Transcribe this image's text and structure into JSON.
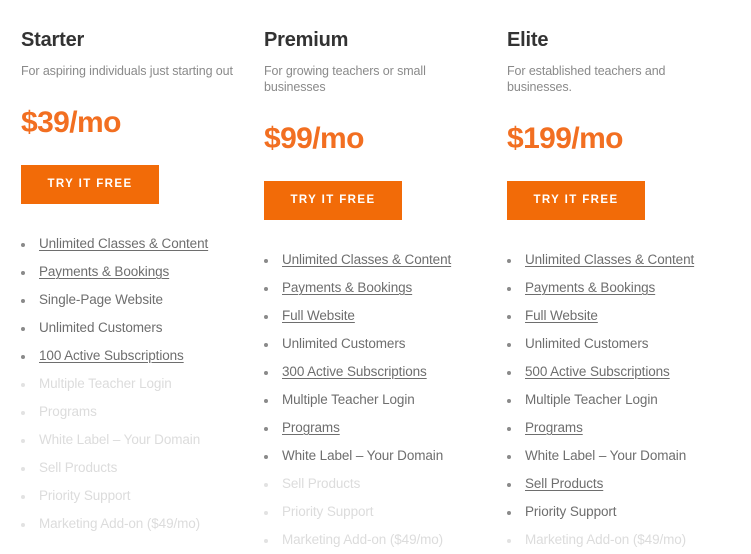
{
  "theme": {
    "accent_orange": "#F26F21",
    "button_orange": "#F26B08",
    "heading_color": "#333333",
    "feature_color": "#6e6e6e",
    "disabled_color": "#dcdcdc"
  },
  "plans": [
    {
      "name": "Starter",
      "tagline": "For aspiring individuals just starting out",
      "price": "$39/mo",
      "cta_label": "TRY IT FREE",
      "features": [
        {
          "label": "Unlimited Classes & Content",
          "enabled": true,
          "has_info": true
        },
        {
          "label": "Payments & Bookings",
          "enabled": true,
          "has_info": true
        },
        {
          "label": "Single-Page Website",
          "enabled": true,
          "has_info": false
        },
        {
          "label": "Unlimited Customers",
          "enabled": true,
          "has_info": false
        },
        {
          "label": "100 Active Subscriptions",
          "enabled": true,
          "has_info": true
        },
        {
          "label": "Multiple Teacher Login",
          "enabled": false,
          "has_info": false
        },
        {
          "label": "Programs",
          "enabled": false,
          "has_info": false
        },
        {
          "label": "White Label – Your Domain",
          "enabled": false,
          "has_info": false
        },
        {
          "label": "Sell Products",
          "enabled": false,
          "has_info": false
        },
        {
          "label": "Priority Support",
          "enabled": false,
          "has_info": false
        },
        {
          "label": "Marketing Add-on ($49/mo)",
          "enabled": false,
          "has_info": false
        }
      ]
    },
    {
      "name": "Premium",
      "tagline": "For growing teachers or small businesses",
      "price": "$99/mo",
      "cta_label": "TRY IT FREE",
      "features": [
        {
          "label": "Unlimited Classes & Content",
          "enabled": true,
          "has_info": true
        },
        {
          "label": "Payments & Bookings",
          "enabled": true,
          "has_info": true
        },
        {
          "label": "Full Website",
          "enabled": true,
          "has_info": true
        },
        {
          "label": "Unlimited Customers",
          "enabled": true,
          "has_info": false
        },
        {
          "label": "300 Active Subscriptions",
          "enabled": true,
          "has_info": true
        },
        {
          "label": "Multiple Teacher Login",
          "enabled": true,
          "has_info": false
        },
        {
          "label": "Programs",
          "enabled": true,
          "has_info": true
        },
        {
          "label": "White Label – Your Domain",
          "enabled": true,
          "has_info": false
        },
        {
          "label": "Sell Products",
          "enabled": false,
          "has_info": false
        },
        {
          "label": "Priority Support",
          "enabled": false,
          "has_info": false
        },
        {
          "label": "Marketing Add-on ($49/mo)",
          "enabled": false,
          "has_info": false
        }
      ]
    },
    {
      "name": "Elite",
      "tagline": "For established teachers and businesses.",
      "price": "$199/mo",
      "cta_label": "TRY IT FREE",
      "features": [
        {
          "label": "Unlimited Classes & Content",
          "enabled": true,
          "has_info": true
        },
        {
          "label": "Payments & Bookings",
          "enabled": true,
          "has_info": true
        },
        {
          "label": "Full Website",
          "enabled": true,
          "has_info": true
        },
        {
          "label": "Unlimited Customers",
          "enabled": true,
          "has_info": false
        },
        {
          "label": "500 Active Subscriptions",
          "enabled": true,
          "has_info": true
        },
        {
          "label": "Multiple Teacher Login",
          "enabled": true,
          "has_info": false
        },
        {
          "label": "Programs",
          "enabled": true,
          "has_info": true
        },
        {
          "label": "White Label – Your Domain",
          "enabled": true,
          "has_info": false
        },
        {
          "label": "Sell Products",
          "enabled": true,
          "has_info": true
        },
        {
          "label": "Priority Support",
          "enabled": true,
          "has_info": false
        },
        {
          "label": "Marketing Add-on ($49/mo)",
          "enabled": false,
          "has_info": false
        }
      ]
    }
  ]
}
